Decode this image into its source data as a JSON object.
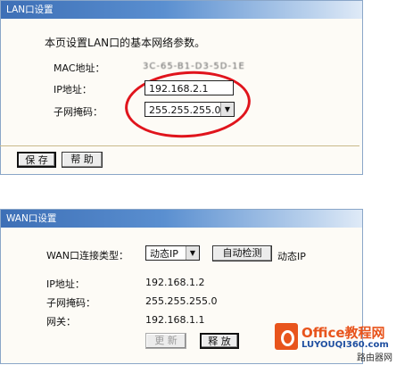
{
  "lan": {
    "title": "LAN口设置",
    "description": "本页设置LAN口的基本网络参数。",
    "mac_label": "MAC地址：",
    "mac_value": "3C-65-B1-D3-5D-1E",
    "ip_label": "IP地址：",
    "ip_value": "192.168.2.1",
    "mask_label": "子网掩码：",
    "mask_value": "255.255.255.0",
    "save_label": "保 存",
    "help_label": "帮 助",
    "highlight_color": "#e0141c"
  },
  "wan": {
    "title": "WAN口设置",
    "type_label": "WAN口连接类型：",
    "type_value": "动态IP",
    "detect_label": "自动检测",
    "type_current": "动态IP",
    "ip_label": "IP地址：",
    "ip_value": "192.168.1.2",
    "mask_label": "子网掩码：",
    "mask_value": "255.255.255.0",
    "gateway_label": "网关：",
    "gateway_value": "192.168.1.1",
    "refresh_label": "更 新",
    "release_label": "释 放"
  },
  "watermark": {
    "brand": "Office教程网",
    "domain": "LUYOUQI360.com",
    "caption": "路由器网"
  }
}
